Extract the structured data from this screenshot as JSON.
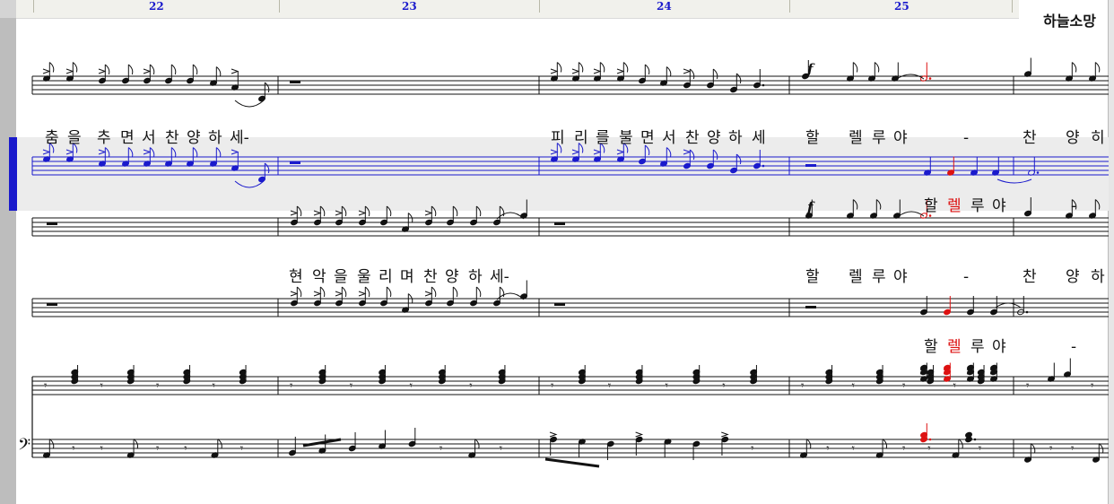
{
  "window": {
    "title": "하늘소망"
  },
  "ruler": {
    "measures": [
      "22",
      "23",
      "24",
      "25"
    ]
  },
  "colors": {
    "default": "#111111",
    "selected": "#1a1acc",
    "highlight": "#dd1111"
  },
  "dynamics": {
    "forte": "f"
  },
  "lyrics": {
    "line1": [
      "춤",
      "을",
      "추",
      "면",
      "서",
      "찬",
      "양",
      "하",
      "세-",
      "피",
      "리",
      "를",
      "불",
      "면",
      "서",
      "찬",
      "양",
      "하",
      "세",
      "할",
      "렐",
      "루",
      "야",
      "-",
      "찬",
      "양",
      "히"
    ],
    "line2": [
      "할",
      "렐",
      "루",
      "야",
      "-"
    ],
    "line3": [
      "현",
      "악",
      "을",
      "울",
      "리",
      "며",
      "찬",
      "양",
      "하",
      "세-",
      "할",
      "렐",
      "루",
      "야",
      "-",
      "찬",
      "양",
      "하"
    ],
    "line4": [
      "할",
      "렐",
      "루",
      "야",
      "-"
    ]
  },
  "lyric_highlight": {
    "line2": 1,
    "line4": 1
  }
}
